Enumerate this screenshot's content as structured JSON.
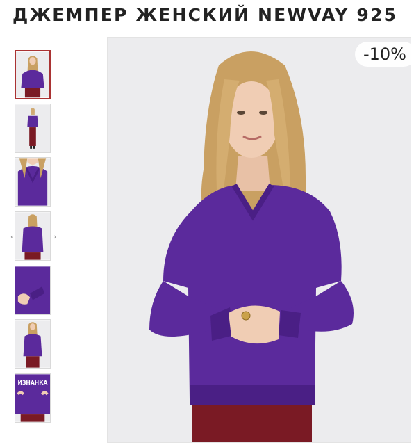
{
  "product": {
    "title": "ДЖЕМПЕР ЖЕНСКИЙ NEWVAY 925"
  },
  "gallery": {
    "discount_badge": "-10%",
    "prev_arrow": "‹",
    "next_arrow": "›",
    "thumbnails": [
      {
        "view": "front-portrait",
        "active": true
      },
      {
        "view": "full-body",
        "active": false
      },
      {
        "view": "neckline-detail",
        "active": false
      },
      {
        "view": "back",
        "active": false
      },
      {
        "view": "cuff-detail",
        "active": false
      },
      {
        "view": "front-portrait-2",
        "active": false
      },
      {
        "view": "inside-out",
        "active": false,
        "caption": "ИЗНАНКА"
      }
    ]
  },
  "colors": {
    "sweater": "#5b2a9c",
    "skirt": "#7a1a24",
    "hair": "#c9a062",
    "skin": "#f0cdb4",
    "background": "#ececee",
    "active_border": "#a33333"
  }
}
